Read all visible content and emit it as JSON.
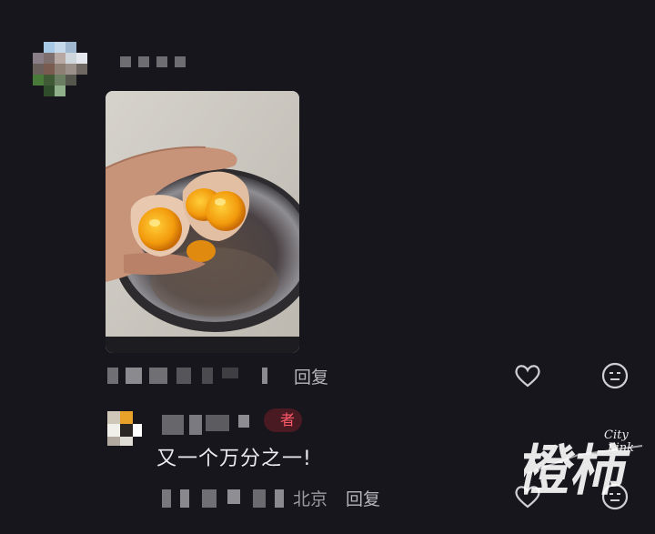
{
  "comment1": {
    "reply_label": "回复"
  },
  "comment2": {
    "tag_label": "者",
    "text": "又一个万分之一!",
    "location": "北京",
    "reply_label": "回复"
  },
  "icons": {
    "like": "heart-icon",
    "emoji": "emoji-face-icon"
  },
  "watermark": {
    "main": "橙柿",
    "sub1": "City",
    "sub2": "Link"
  },
  "colors": {
    "background": "#17161c",
    "tag_text": "#ff5a6a",
    "tag_bg": "#4a1a22"
  }
}
